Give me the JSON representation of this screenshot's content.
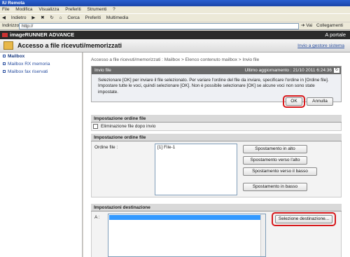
{
  "browser": {
    "title": "IU Remota",
    "menu": [
      "File",
      "Modifica",
      "Visualizza",
      "Preferiti",
      "Strumenti",
      "?"
    ],
    "toolbar": [
      "Indietro",
      "Cerca",
      "Preferiti",
      "Multimedia"
    ],
    "address_label": "Indirizzo",
    "address_value": "http://",
    "go_label": "Vai",
    "links_label": "Collegamenti"
  },
  "app": {
    "brand": "imageRUNNER ADVANCE",
    "portal_link": "A portale",
    "page_title": "Accesso a file ricevuti/memorizzati",
    "back_link": "Invio a gestore sistema"
  },
  "sidebar": {
    "items": [
      {
        "label": "Mailbox"
      },
      {
        "label": "Mailbox RX memoria"
      },
      {
        "label": "Mailbox fax riservati"
      }
    ]
  },
  "main": {
    "breadcrumb": "Accesso a file ricevuti/memorizzati : Mailbox > Elenco contenuto mailbox > Invio file",
    "send": {
      "title": "Invio file",
      "last_update": "Ultimo aggiornamento : 21/10 2011 6:24:36",
      "message": "Selezionare [OK] per inviare il file selezionato. Per variare l'ordine del file da inviare, specificare l'ordine in [Ordine file]. Impostare tutte le voci, quindi selezionare [OK]. Non è possibile selezionare [OK] se alcune voci non sono state impostate.",
      "ok_label": "OK",
      "cancel_label": "Annulla"
    },
    "order_settings": {
      "title": "Impostazione ordine file",
      "delete_after_send": "Eliminazione file dopo invio"
    },
    "file_order": {
      "title": "Impostazione ordine file",
      "label": "Ordine file :",
      "files": [
        "[1] File-1"
      ],
      "move_top": "Spostamento in alto",
      "move_up": "Spostamento verso l'alto",
      "move_down": "Spostamento verso il basso",
      "move_bottom": "Spostamento in basso"
    },
    "destination": {
      "title": "Impostazioni destinazione",
      "to_label": "A :",
      "select_button": "Selezione destinazione..."
    }
  }
}
